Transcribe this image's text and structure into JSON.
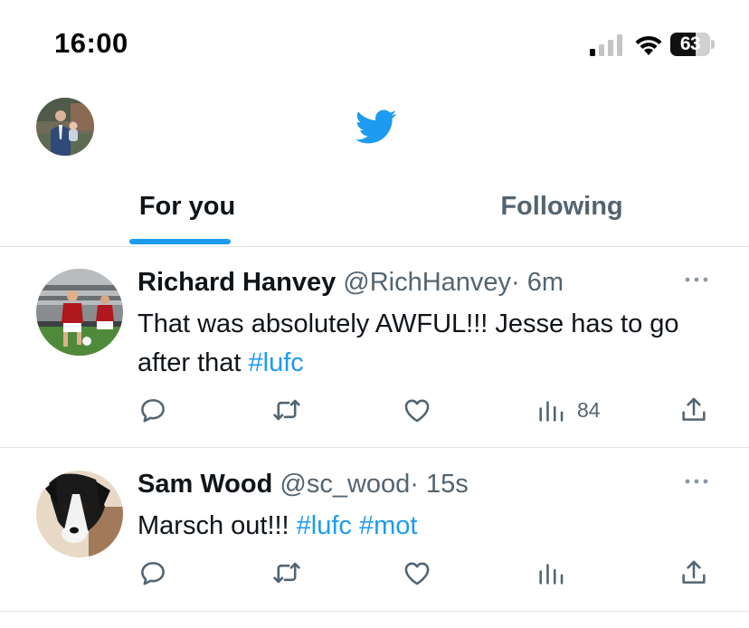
{
  "status_bar": {
    "time": "16:00",
    "battery_level": "63",
    "battery_fraction": 0.63
  },
  "header": {
    "logo_icon": "twitter-bird-icon",
    "avatar": "profile-photo"
  },
  "tabs": [
    {
      "label": "For you",
      "active": true
    },
    {
      "label": "Following",
      "active": false
    }
  ],
  "colors": {
    "accent": "#1d9bf0",
    "text": "#0f1419",
    "secondary": "#536471",
    "divider": "#e1e5e8"
  },
  "tweets": [
    {
      "name": "Richard Hanvey",
      "handle": "@RichHanvey",
      "dot": "·",
      "time": "6m",
      "text": "That was absolutely AWFUL!!! Jesse has to go after that ",
      "hashtags": [
        "#lufc"
      ],
      "views": "84",
      "avatar": "football-players-photo"
    },
    {
      "name": "Sam Wood",
      "handle": "@sc_wood",
      "dot": "·",
      "time": "15s",
      "text": "Marsch out!!! ",
      "hashtags": [
        "#lufc",
        "#mot"
      ],
      "views": "",
      "avatar": "dog-photo"
    }
  ],
  "icons": [
    "reply-icon",
    "retweet-icon",
    "like-icon",
    "views-icon",
    "share-icon",
    "more-icon"
  ]
}
